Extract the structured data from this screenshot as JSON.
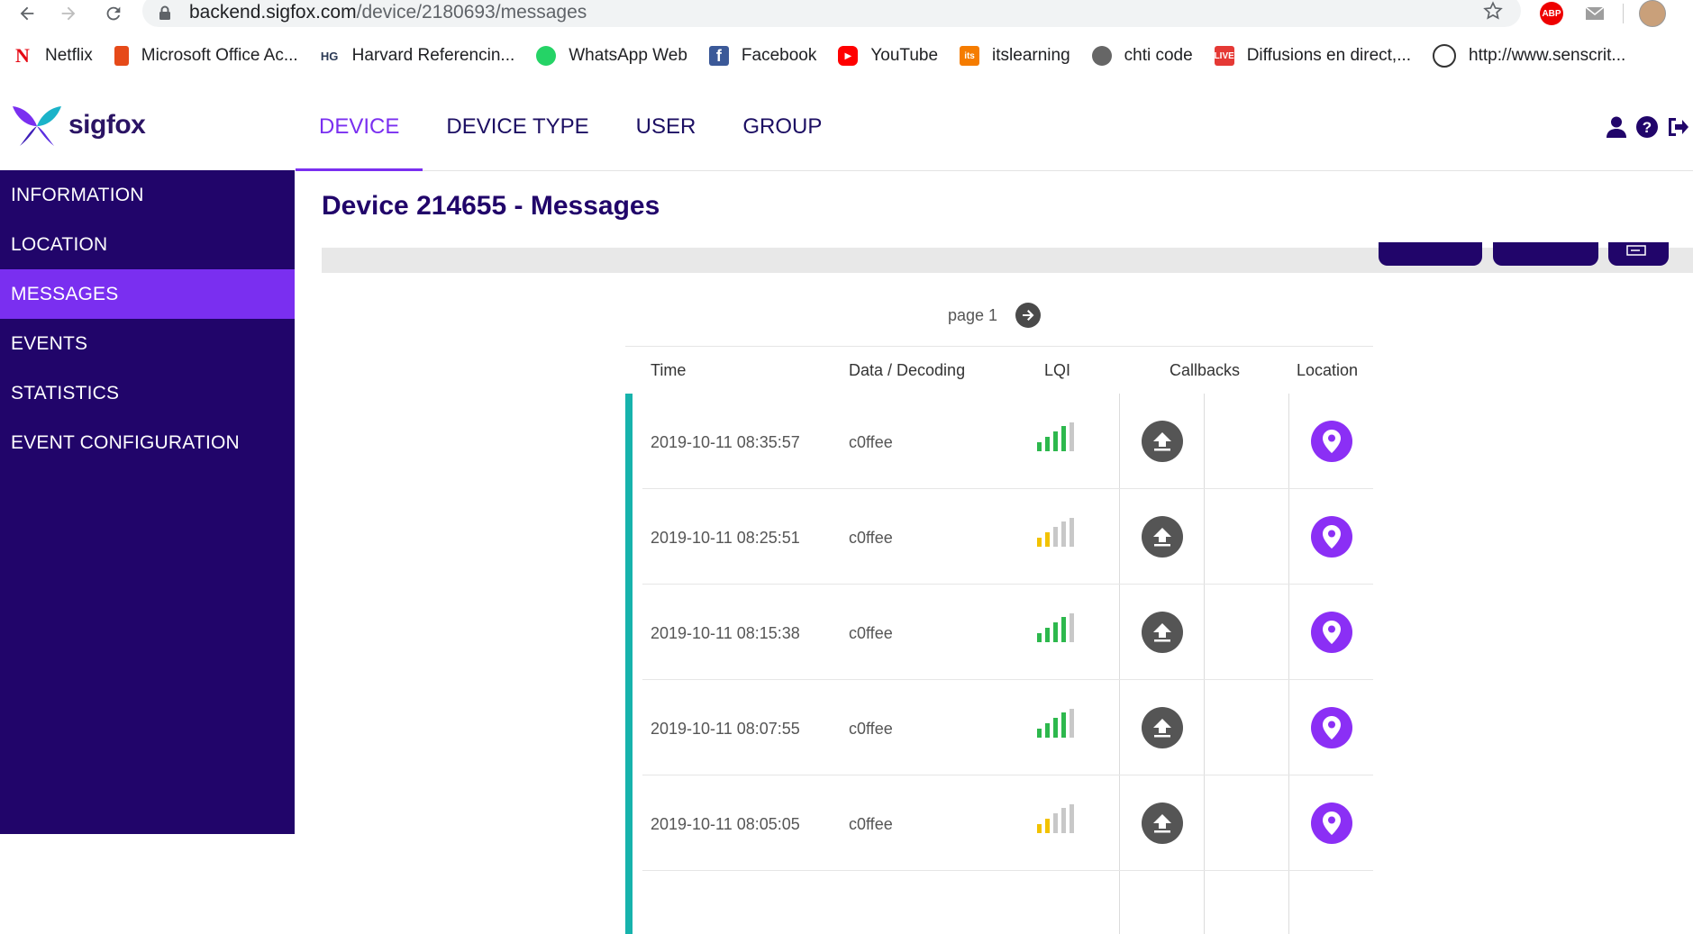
{
  "browser": {
    "url_host": "backend.sigfox.com",
    "url_path": "/device/2180693/messages",
    "abp_label": "ABP",
    "bookmarks": [
      {
        "label": "Netflix",
        "icon": "netflix-icon",
        "icon_text": "N",
        "color": "#e50914"
      },
      {
        "label": "Microsoft Office Ac...",
        "icon": "office-icon",
        "icon_text": "",
        "color": "#e64a19"
      },
      {
        "label": "Harvard Referencin...",
        "icon": "hg-icon",
        "icon_text": "HG",
        "color": "#2b3a55"
      },
      {
        "label": "WhatsApp Web",
        "icon": "whatsapp-icon",
        "icon_text": "",
        "color": "#25d366"
      },
      {
        "label": "Facebook",
        "icon": "facebook-icon",
        "icon_text": "f",
        "color": "#3b5998"
      },
      {
        "label": "YouTube",
        "icon": "youtube-icon",
        "icon_text": "▶",
        "color": "#ff0000"
      },
      {
        "label": "itslearning",
        "icon": "itslearning-icon",
        "icon_text": "its",
        "color": "#f57c00"
      },
      {
        "label": "chti code",
        "icon": "globe-icon",
        "icon_text": "",
        "color": "#666666"
      },
      {
        "label": "Diffusions en direct,...",
        "icon": "live-icon",
        "icon_text": "LIVE",
        "color": "#e53935"
      },
      {
        "label": "http://www.senscrit...",
        "icon": "senscritique-icon",
        "icon_text": "",
        "color": "#333333"
      }
    ]
  },
  "app": {
    "brand": "sigfox",
    "nav": [
      {
        "label": "DEVICE",
        "active": true
      },
      {
        "label": "DEVICE TYPE",
        "active": false
      },
      {
        "label": "USER",
        "active": false
      },
      {
        "label": "GROUP",
        "active": false
      }
    ],
    "sidebar": [
      {
        "label": "INFORMATION"
      },
      {
        "label": "LOCATION"
      },
      {
        "label": "MESSAGES"
      },
      {
        "label": "EVENTS"
      },
      {
        "label": "STATISTICS"
      },
      {
        "label": "EVENT CONFIGURATION"
      }
    ],
    "sidebar_active_index": 2,
    "accent_color": "#7a2ff0",
    "sidebar_color": "#21056a"
  },
  "main": {
    "title": "Device 214655 - Messages",
    "pager_label": "page 1",
    "columns": [
      "Time",
      "Data / Decoding",
      "LQI",
      "Callbacks",
      "Location"
    ],
    "rows": [
      {
        "time": "2019-10-11 08:35:57",
        "data": "c0ffee",
        "lqi": 4,
        "lqi_color": "#2db84d"
      },
      {
        "time": "2019-10-11 08:25:51",
        "data": "c0ffee",
        "lqi": 2,
        "lqi_color": "#f2c200"
      },
      {
        "time": "2019-10-11 08:15:38",
        "data": "c0ffee",
        "lqi": 4,
        "lqi_color": "#2db84d"
      },
      {
        "time": "2019-10-11 08:07:55",
        "data": "c0ffee",
        "lqi": 4,
        "lqi_color": "#2db84d"
      },
      {
        "time": "2019-10-11 08:05:05",
        "data": "c0ffee",
        "lqi": 2,
        "lqi_color": "#f2c200"
      }
    ]
  }
}
